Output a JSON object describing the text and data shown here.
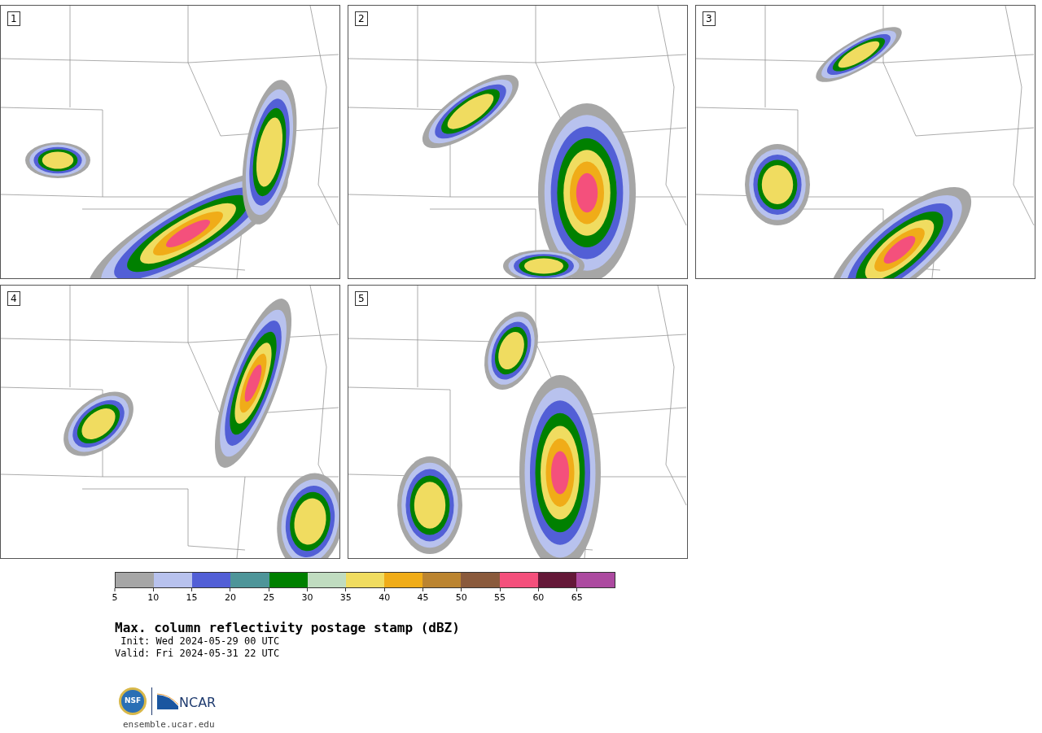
{
  "panels": [
    {
      "label": "1"
    },
    {
      "label": "2"
    },
    {
      "label": "3"
    },
    {
      "label": "4"
    },
    {
      "label": "5"
    }
  ],
  "colorbar": {
    "bins": [
      {
        "color": "#a6a6a6"
      },
      {
        "color": "#b8c2ee"
      },
      {
        "color": "#525fd6"
      },
      {
        "color": "#4e9599"
      },
      {
        "color": "#008000"
      },
      {
        "color": "#c0dcc0"
      },
      {
        "color": "#f0dc60"
      },
      {
        "color": "#f0ac18"
      },
      {
        "color": "#bb8430"
      },
      {
        "color": "#8a5a3c"
      },
      {
        "color": "#f4507c"
      },
      {
        "color": "#641838"
      },
      {
        "color": "#ac4aa0"
      }
    ],
    "ticks": [
      "5",
      "10",
      "15",
      "20",
      "25",
      "30",
      "35",
      "40",
      "45",
      "50",
      "55",
      "60",
      "65"
    ]
  },
  "title": "Max. column reflectivity postage stamp (dBZ)",
  "init": " Init: Wed 2024-05-29 00 UTC",
  "valid": "Valid: Fri 2024-05-31 22 UTC",
  "logos": {
    "nsf": "NSF",
    "ncar": "NCAR"
  },
  "footer": "ensemble.ucar.edu"
}
